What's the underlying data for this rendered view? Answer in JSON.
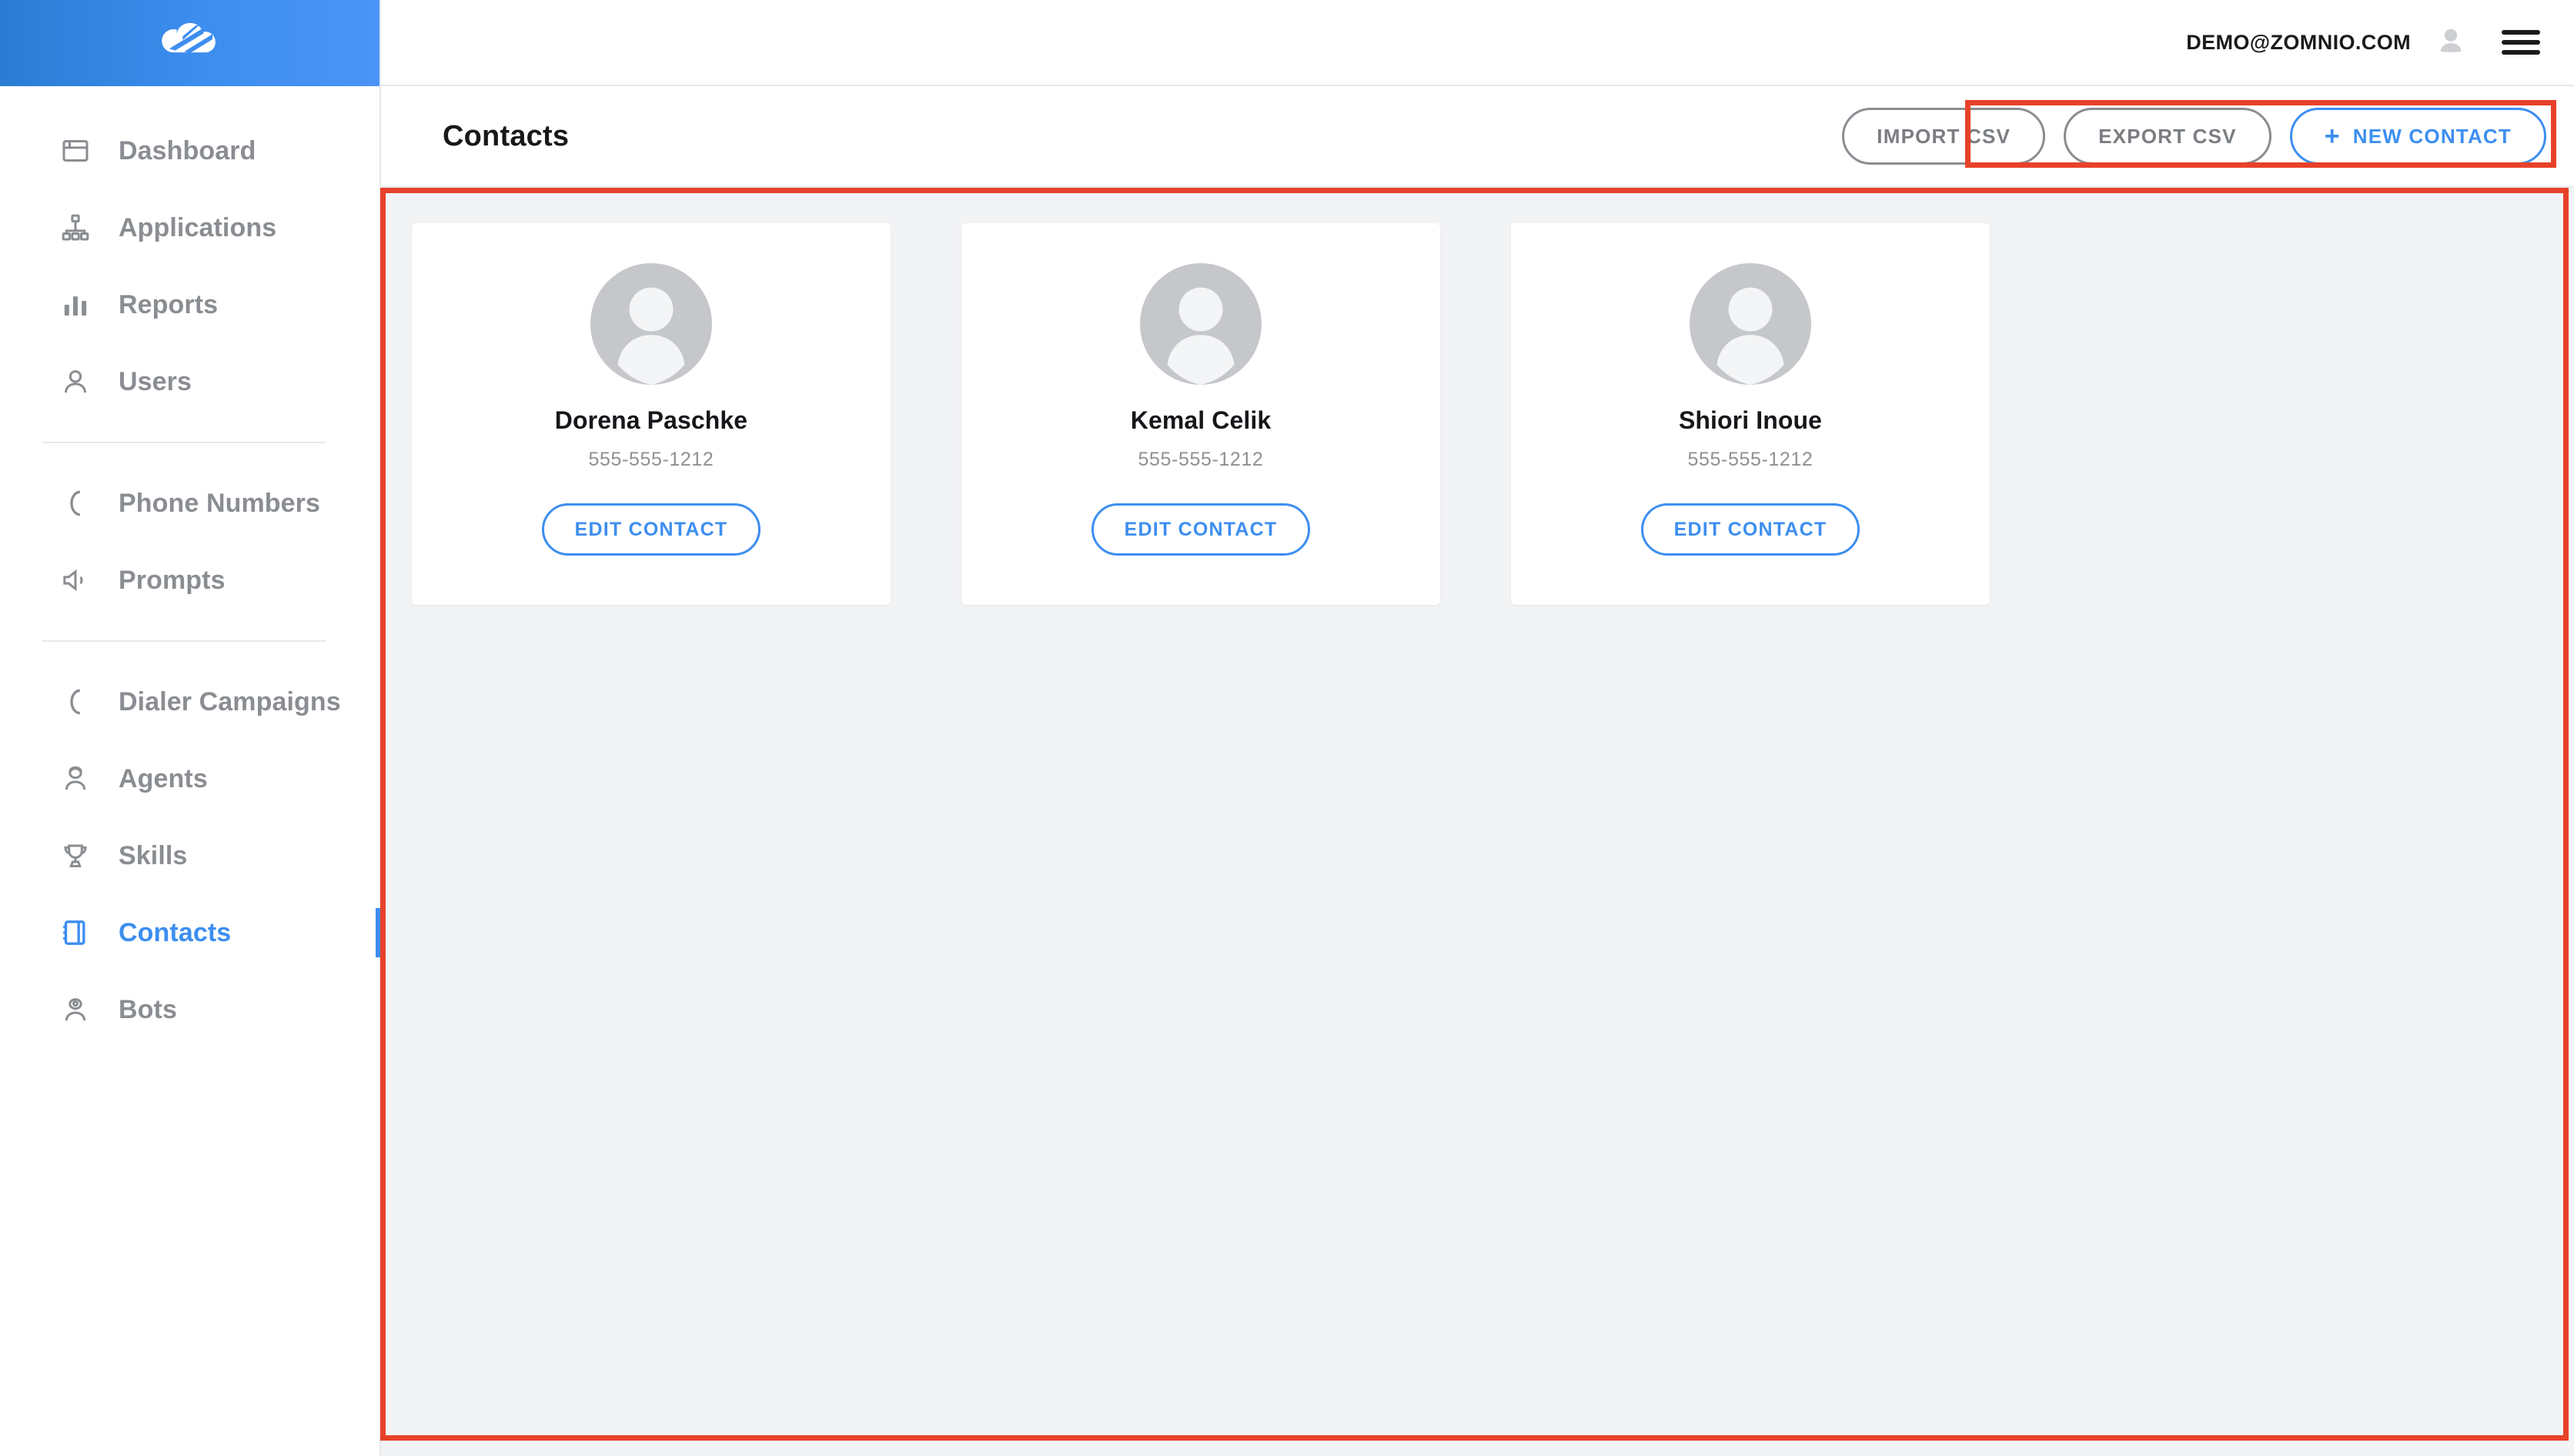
{
  "brand": {
    "logo_icon": "cloud-logo-icon",
    "header_gradient_from": "#2b7cd3",
    "header_gradient_to": "#4a93f7"
  },
  "colors": {
    "accent": "#3d8ef0",
    "muted_text": "#8a8d91",
    "content_bg": "#f2f3f5",
    "annotation": "#e8412a"
  },
  "sidebar": {
    "groups": [
      {
        "items": [
          {
            "label": "Dashboard",
            "icon": "window-icon",
            "active": false
          },
          {
            "label": "Applications",
            "icon": "sitemap-icon",
            "active": false
          },
          {
            "label": "Reports",
            "icon": "bar-chart-icon",
            "active": false
          },
          {
            "label": "Users",
            "icon": "user-icon",
            "active": false
          }
        ]
      },
      {
        "items": [
          {
            "label": "Phone Numbers",
            "icon": "phone-icon",
            "active": false
          },
          {
            "label": "Prompts",
            "icon": "speaker-icon",
            "active": false
          }
        ]
      },
      {
        "items": [
          {
            "label": "Dialer Campaigns",
            "icon": "phone-icon",
            "active": false
          },
          {
            "label": "Agents",
            "icon": "headset-user-icon",
            "active": false
          },
          {
            "label": "Skills",
            "icon": "trophy-icon",
            "active": false
          },
          {
            "label": "Contacts",
            "icon": "address-book-icon",
            "active": true
          },
          {
            "label": "Bots",
            "icon": "robot-icon",
            "active": false
          }
        ]
      }
    ]
  },
  "topbar": {
    "user_email": "DEMO@ZOMNIO.COM",
    "avatar_icon": "user-avatar-icon",
    "menu_icon": "hamburger-menu-icon"
  },
  "pagebar": {
    "title": "Contacts",
    "actions": [
      {
        "label": "IMPORT CSV",
        "style": "outline-gray",
        "plus": false
      },
      {
        "label": "EXPORT CSV",
        "style": "outline-gray",
        "plus": false
      },
      {
        "label": "NEW CONTACT",
        "style": "outline-blue",
        "plus": true,
        "plus_glyph": "+"
      }
    ]
  },
  "contacts": {
    "edit_label": "EDIT CONTACT",
    "items": [
      {
        "name": "Dorena Paschke",
        "phone": "555-555-1212",
        "avatar_icon": "contact-avatar-icon"
      },
      {
        "name": "Kemal Celik",
        "phone": "555-555-1212",
        "avatar_icon": "contact-avatar-icon"
      },
      {
        "name": "Shiori Inoue",
        "phone": "555-555-1212",
        "avatar_icon": "contact-avatar-icon"
      }
    ]
  },
  "annotations": [
    {
      "name": "header-actions-highlight"
    },
    {
      "name": "contacts-content-highlight"
    }
  ]
}
